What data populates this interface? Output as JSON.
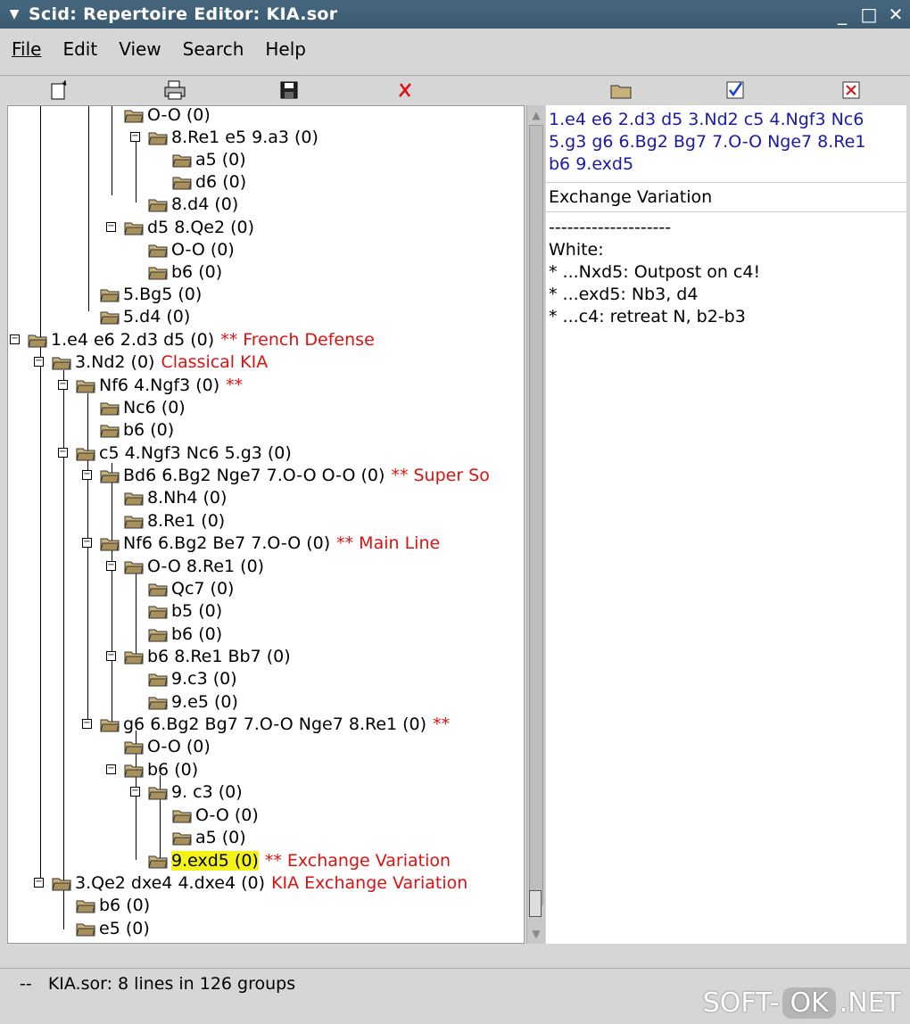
{
  "window": {
    "title": "Scid: Repertoire Editor: KIA.sor"
  },
  "menu": [
    "File",
    "Edit",
    "View",
    "Search",
    "Help"
  ],
  "toolbar": {
    "left": [
      "new-icon",
      "print-icon",
      "save-icon",
      "close-red-x-icon"
    ],
    "right": [
      "open-folder-icon",
      "checkbox-checked-icon",
      "checkbox-x-icon"
    ]
  },
  "tree": {
    "top_partial": "O-O (0)",
    "n1": "8.Re1 e5 9.a3 (0)",
    "n2": "a5 (0)",
    "n3": "d6 (0)",
    "n4": "8.d4 (0)",
    "n5": "d5 8.Qe2 (0)",
    "n6": "O-O (0)",
    "n7": "b6 (0)",
    "n8": "5.Bg5 (0)",
    "n9": "5.d4 (0)",
    "n10": "1.e4 e6 2.d3 d5 (0)",
    "n10c": "** French Defense",
    "n11": "3.Nd2 (0)",
    "n11c": "Classical KIA",
    "n12": "Nf6 4.Ngf3 (0)",
    "n12c": "**",
    "n13": "Nc6 (0)",
    "n14": "b6 (0)",
    "n15": "c5 4.Ngf3 Nc6 5.g3 (0)",
    "n16": "Bd6 6.Bg2 Nge7 7.O-O O-O (0)",
    "n16c": "** Super So",
    "n17": "8.Nh4 (0)",
    "n18": "8.Re1 (0)",
    "n19": "Nf6 6.Bg2 Be7 7.O-O (0)",
    "n19c": "** Main Line",
    "n20": "O-O 8.Re1 (0)",
    "n21": "Qc7 (0)",
    "n22": "b5 (0)",
    "n23": "b6 (0)",
    "n24": "b6 8.Re1 Bb7 (0)",
    "n25": "9.c3 (0)",
    "n26": "9.e5 (0)",
    "n27": "g6 6.Bg2 Bg7 7.O-O Nge7 8.Re1 (0)",
    "n27c": "**",
    "n28": "O-O (0)",
    "n29": "b6 (0)",
    "n30": "9. c3 (0)",
    "n31": "O-O (0)",
    "n32": "a5 (0)",
    "n33": "9.exd5 (0)",
    "n33c": "** Exchange Variation",
    "n34": "3.Qe2 dxe4 4.dxe4 (0)",
    "n34c": "KIA Exchange Variation",
    "n35": "b6 (0)",
    "n36": "e5 (0)"
  },
  "detail": {
    "moves_line1": "1.e4 e6 2.d3 d5 3.Nd2 c5 4.Ngf3 Nc6",
    "moves_line2": "5.g3 g6 6.Bg2 Bg7 7.O-O Nge7 8.Re1",
    "moves_line3": "b6 9.exd5",
    "name": "Exchange Variation",
    "notes": [
      "--------------------",
      "White:",
      "* ...Nxd5: Outpost on c4!",
      "* ...exd5: Nb3, d4",
      "* ...c4: retreat N, b2-b3"
    ]
  },
  "status": "--   KIA.sor: 8 lines in 126 groups",
  "watermark": {
    "a": "SOFT-",
    "b": "OK",
    "c": ".NET"
  }
}
